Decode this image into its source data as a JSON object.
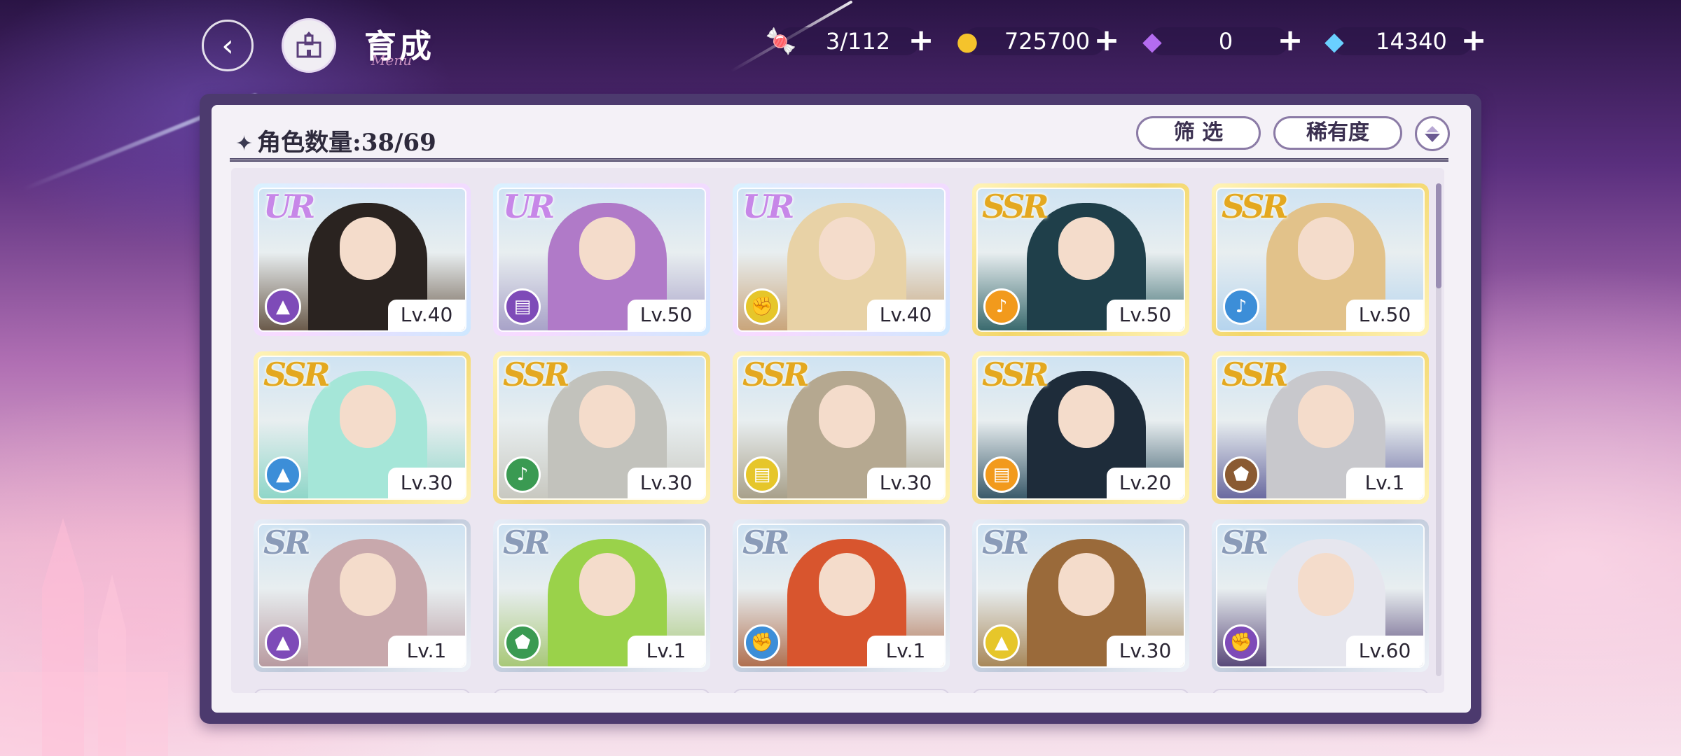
{
  "header": {
    "title": "育成",
    "title_deco": "Menu"
  },
  "resources": [
    {
      "name": "stamina",
      "icon": "candy-icon",
      "value": "3/112",
      "color": "#f07aa6"
    },
    {
      "name": "gold",
      "icon": "coin-icon",
      "value": "725700",
      "color": "#f5c32c"
    },
    {
      "name": "paid-gem",
      "icon": "rainbow-diamond-icon",
      "value": "0",
      "color": "#b46cf0"
    },
    {
      "name": "free-gem",
      "icon": "diamond-icon",
      "value": "14340",
      "color": "#6ad0ff"
    }
  ],
  "panel": {
    "count_label": "角色数量:38/69",
    "filter_label": "筛 选",
    "rarity_label": "稀有度"
  },
  "cards": [
    {
      "rarity": "UR",
      "level": "Lv.40",
      "class_color": "#7e4bb8",
      "class_icon": "boot-icon",
      "art": "#6a5a4a",
      "hair": "#2a2320"
    },
    {
      "rarity": "UR",
      "level": "Lv.50",
      "class_color": "#7e4bb8",
      "class_icon": "book-icon",
      "art": "#a8a2c8",
      "hair": "#b07ac8"
    },
    {
      "rarity": "UR",
      "level": "Lv.40",
      "class_color": "#e6c62a",
      "class_icon": "fist-icon",
      "art": "#c9a57a",
      "hair": "#e8d2a6"
    },
    {
      "rarity": "SSR",
      "level": "Lv.50",
      "class_color": "#f29a1c",
      "class_icon": "horn-icon",
      "art": "#3a6a6e",
      "hair": "#1f3f4a"
    },
    {
      "rarity": "SSR",
      "level": "Lv.50",
      "class_color": "#3c8ed8",
      "class_icon": "horn-icon",
      "art": "#b5d4ee",
      "hair": "#e2c28a"
    },
    {
      "rarity": "SSR",
      "level": "Lv.30",
      "class_color": "#3c8ed8",
      "class_icon": "boot-icon",
      "art": "#8fd6c8",
      "hair": "#a5e6d8"
    },
    {
      "rarity": "SSR",
      "level": "Lv.30",
      "class_color": "#3a9a52",
      "class_icon": "horn-icon",
      "art": "#c8c8c0",
      "hair": "#c2c2bc"
    },
    {
      "rarity": "SSR",
      "level": "Lv.30",
      "class_color": "#e6c62a",
      "class_icon": "book-icon",
      "art": "#a8a08a",
      "hair": "#b5a890"
    },
    {
      "rarity": "SSR",
      "level": "Lv.20",
      "class_color": "#f29a1c",
      "class_icon": "book-icon",
      "art": "#3a5a6a",
      "hair": "#1e2c3a"
    },
    {
      "rarity": "SSR",
      "level": "Lv.1",
      "class_color": "#8a5a32",
      "class_icon": "shield-icon",
      "art": "#6a6aa0",
      "hair": "#c8c8cc"
    },
    {
      "rarity": "SR",
      "level": "Lv.1",
      "class_color": "#7e4bb8",
      "class_icon": "boot-icon",
      "art": "#b89aa0",
      "hair": "#c8a8ac"
    },
    {
      "rarity": "SR",
      "level": "Lv.1",
      "class_color": "#3a9a52",
      "class_icon": "shield-icon",
      "art": "#a8c878",
      "hair": "#9ad24a"
    },
    {
      "rarity": "SR",
      "level": "Lv.1",
      "class_color": "#3c8ed8",
      "class_icon": "fist-icon",
      "art": "#b07050",
      "hair": "#d8552e"
    },
    {
      "rarity": "SR",
      "level": "Lv.30",
      "class_color": "#e6c62a",
      "class_icon": "boot-icon",
      "art": "#a8885a",
      "hair": "#9a6a3a"
    },
    {
      "rarity": "SR",
      "level": "Lv.60",
      "class_color": "#7e4bb8",
      "class_icon": "fist-icon",
      "art": "#5a4a7a",
      "hair": "#e6e6ee"
    }
  ]
}
